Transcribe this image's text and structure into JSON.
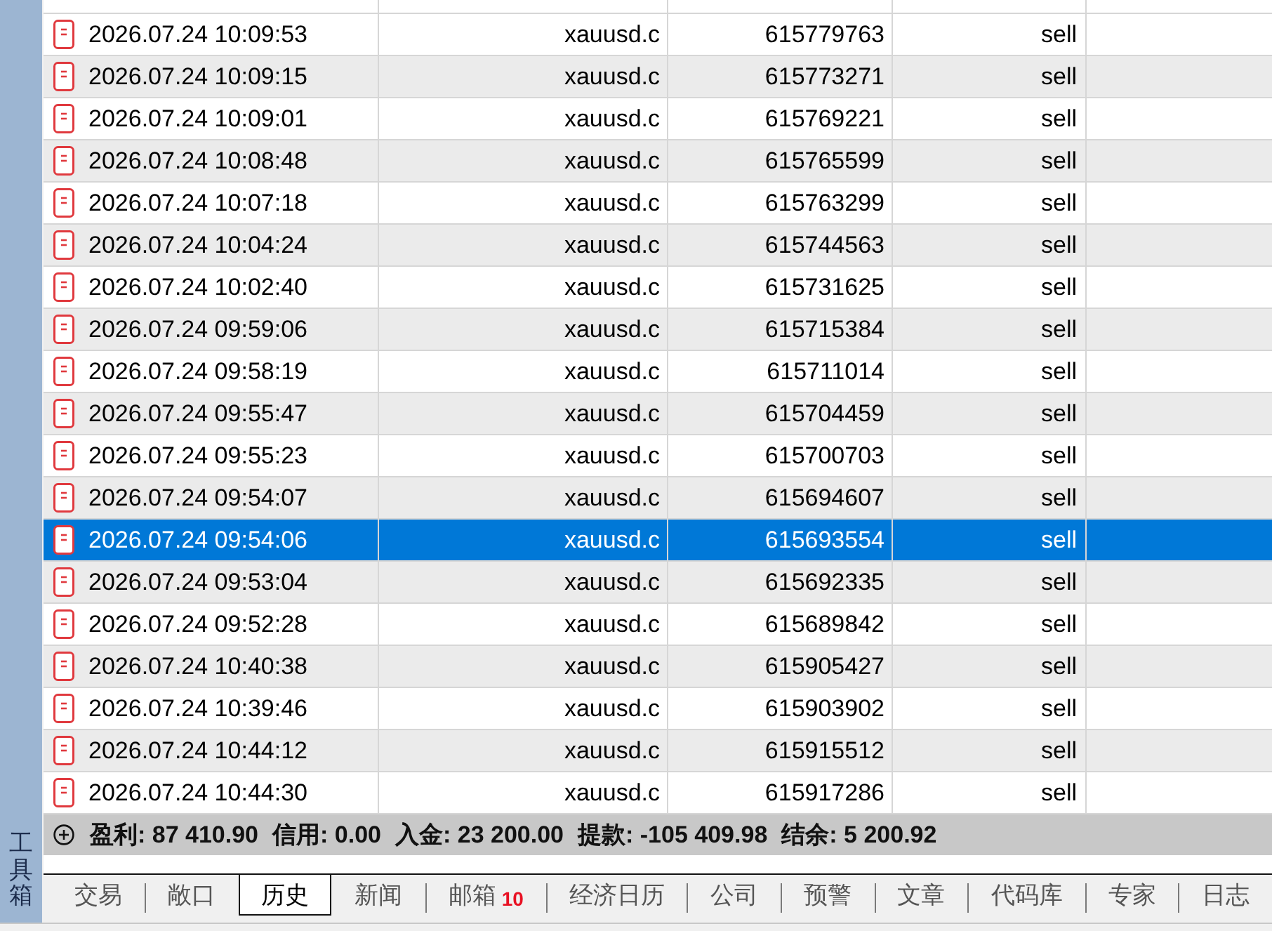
{
  "sidebar": {
    "title": "工具箱"
  },
  "table": {
    "rows": [
      {
        "cells": [
          "2026.07.24 10:09:53",
          "xauusd.c",
          "615779763",
          "sell"
        ],
        "selected": false
      },
      {
        "cells": [
          "2026.07.24 10:09:15",
          "xauusd.c",
          "615773271",
          "sell"
        ],
        "selected": false
      },
      {
        "cells": [
          "2026.07.24 10:09:01",
          "xauusd.c",
          "615769221",
          "sell"
        ],
        "selected": false
      },
      {
        "cells": [
          "2026.07.24 10:08:48",
          "xauusd.c",
          "615765599",
          "sell"
        ],
        "selected": false
      },
      {
        "cells": [
          "2026.07.24 10:07:18",
          "xauusd.c",
          "615763299",
          "sell"
        ],
        "selected": false
      },
      {
        "cells": [
          "2026.07.24 10:04:24",
          "xauusd.c",
          "615744563",
          "sell"
        ],
        "selected": false
      },
      {
        "cells": [
          "2026.07.24 10:02:40",
          "xauusd.c",
          "615731625",
          "sell"
        ],
        "selected": false
      },
      {
        "cells": [
          "2026.07.24 09:59:06",
          "xauusd.c",
          "615715384",
          "sell"
        ],
        "selected": false
      },
      {
        "cells": [
          "2026.07.24 09:58:19",
          "xauusd.c",
          "615711014",
          "sell"
        ],
        "selected": false
      },
      {
        "cells": [
          "2026.07.24 09:55:47",
          "xauusd.c",
          "615704459",
          "sell"
        ],
        "selected": false
      },
      {
        "cells": [
          "2026.07.24 09:55:23",
          "xauusd.c",
          "615700703",
          "sell"
        ],
        "selected": false
      },
      {
        "cells": [
          "2026.07.24 09:54:07",
          "xauusd.c",
          "615694607",
          "sell"
        ],
        "selected": false
      },
      {
        "cells": [
          "2026.07.24 09:54:06",
          "xauusd.c",
          "615693554",
          "sell"
        ],
        "selected": true
      },
      {
        "cells": [
          "2026.07.24 09:53:04",
          "xauusd.c",
          "615692335",
          "sell"
        ],
        "selected": false
      },
      {
        "cells": [
          "2026.07.24 09:52:28",
          "xauusd.c",
          "615689842",
          "sell"
        ],
        "selected": false
      },
      {
        "cells": [
          "2026.07.24 10:40:38",
          "xauusd.c",
          "615905427",
          "sell"
        ],
        "selected": false
      },
      {
        "cells": [
          "2026.07.24 10:39:46",
          "xauusd.c",
          "615903902",
          "sell"
        ],
        "selected": false
      },
      {
        "cells": [
          "2026.07.24 10:44:12",
          "xauusd.c",
          "615915512",
          "sell"
        ],
        "selected": false
      },
      {
        "cells": [
          "2026.07.24 10:44:30",
          "xauusd.c",
          "615917286",
          "sell"
        ],
        "selected": false
      }
    ]
  },
  "summary": {
    "items": [
      "盈利: 87 410.90",
      "信用: 0.00",
      "入金: 23 200.00",
      "提款: -105 409.98",
      "结余: 5 200.92"
    ]
  },
  "tabs": [
    {
      "label": "交易",
      "selected": false
    },
    {
      "label": "敞口",
      "selected": false
    },
    {
      "label": "历史",
      "selected": true
    },
    {
      "label": "新闻",
      "selected": false
    },
    {
      "label": "邮箱",
      "selected": false,
      "badge": "10"
    },
    {
      "label": "经济日历",
      "selected": false
    },
    {
      "label": "公司",
      "selected": false
    },
    {
      "label": "预警",
      "selected": false
    },
    {
      "label": "文章",
      "selected": false
    },
    {
      "label": "代码库",
      "selected": false
    },
    {
      "label": "专家",
      "selected": false
    },
    {
      "label": "日志",
      "selected": false
    }
  ]
}
